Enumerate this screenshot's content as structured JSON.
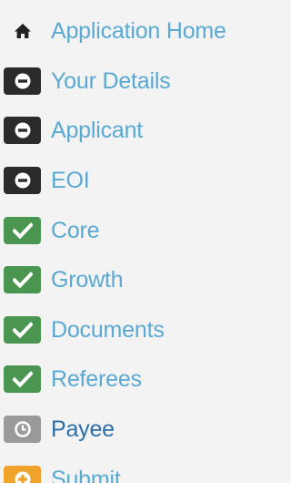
{
  "colors": {
    "link": "#5aa9d3",
    "active_link": "#2b6fa8",
    "dark_box": "#2b2b2b",
    "success_box": "#4a9650",
    "pending_box": "#9a9a9a",
    "warning_box": "#f0a32a",
    "background": "#f3f3f3"
  },
  "nav": {
    "items": [
      {
        "label": "Application Home",
        "icon": "home-icon",
        "status": "home"
      },
      {
        "label": "Your Details",
        "icon": "minus-circle-icon",
        "status": "incomplete"
      },
      {
        "label": "Applicant",
        "icon": "minus-circle-icon",
        "status": "incomplete"
      },
      {
        "label": "EOI",
        "icon": "minus-circle-icon",
        "status": "incomplete"
      },
      {
        "label": "Core",
        "icon": "checkmark-icon",
        "status": "complete"
      },
      {
        "label": "Growth",
        "icon": "checkmark-icon",
        "status": "complete"
      },
      {
        "label": "Documents",
        "icon": "checkmark-icon",
        "status": "complete"
      },
      {
        "label": "Referees",
        "icon": "checkmark-icon",
        "status": "complete"
      },
      {
        "label": "Payee",
        "icon": "clock-icon",
        "status": "pending"
      },
      {
        "label": "Submit",
        "icon": "plus-circle-icon",
        "status": "action"
      }
    ]
  }
}
